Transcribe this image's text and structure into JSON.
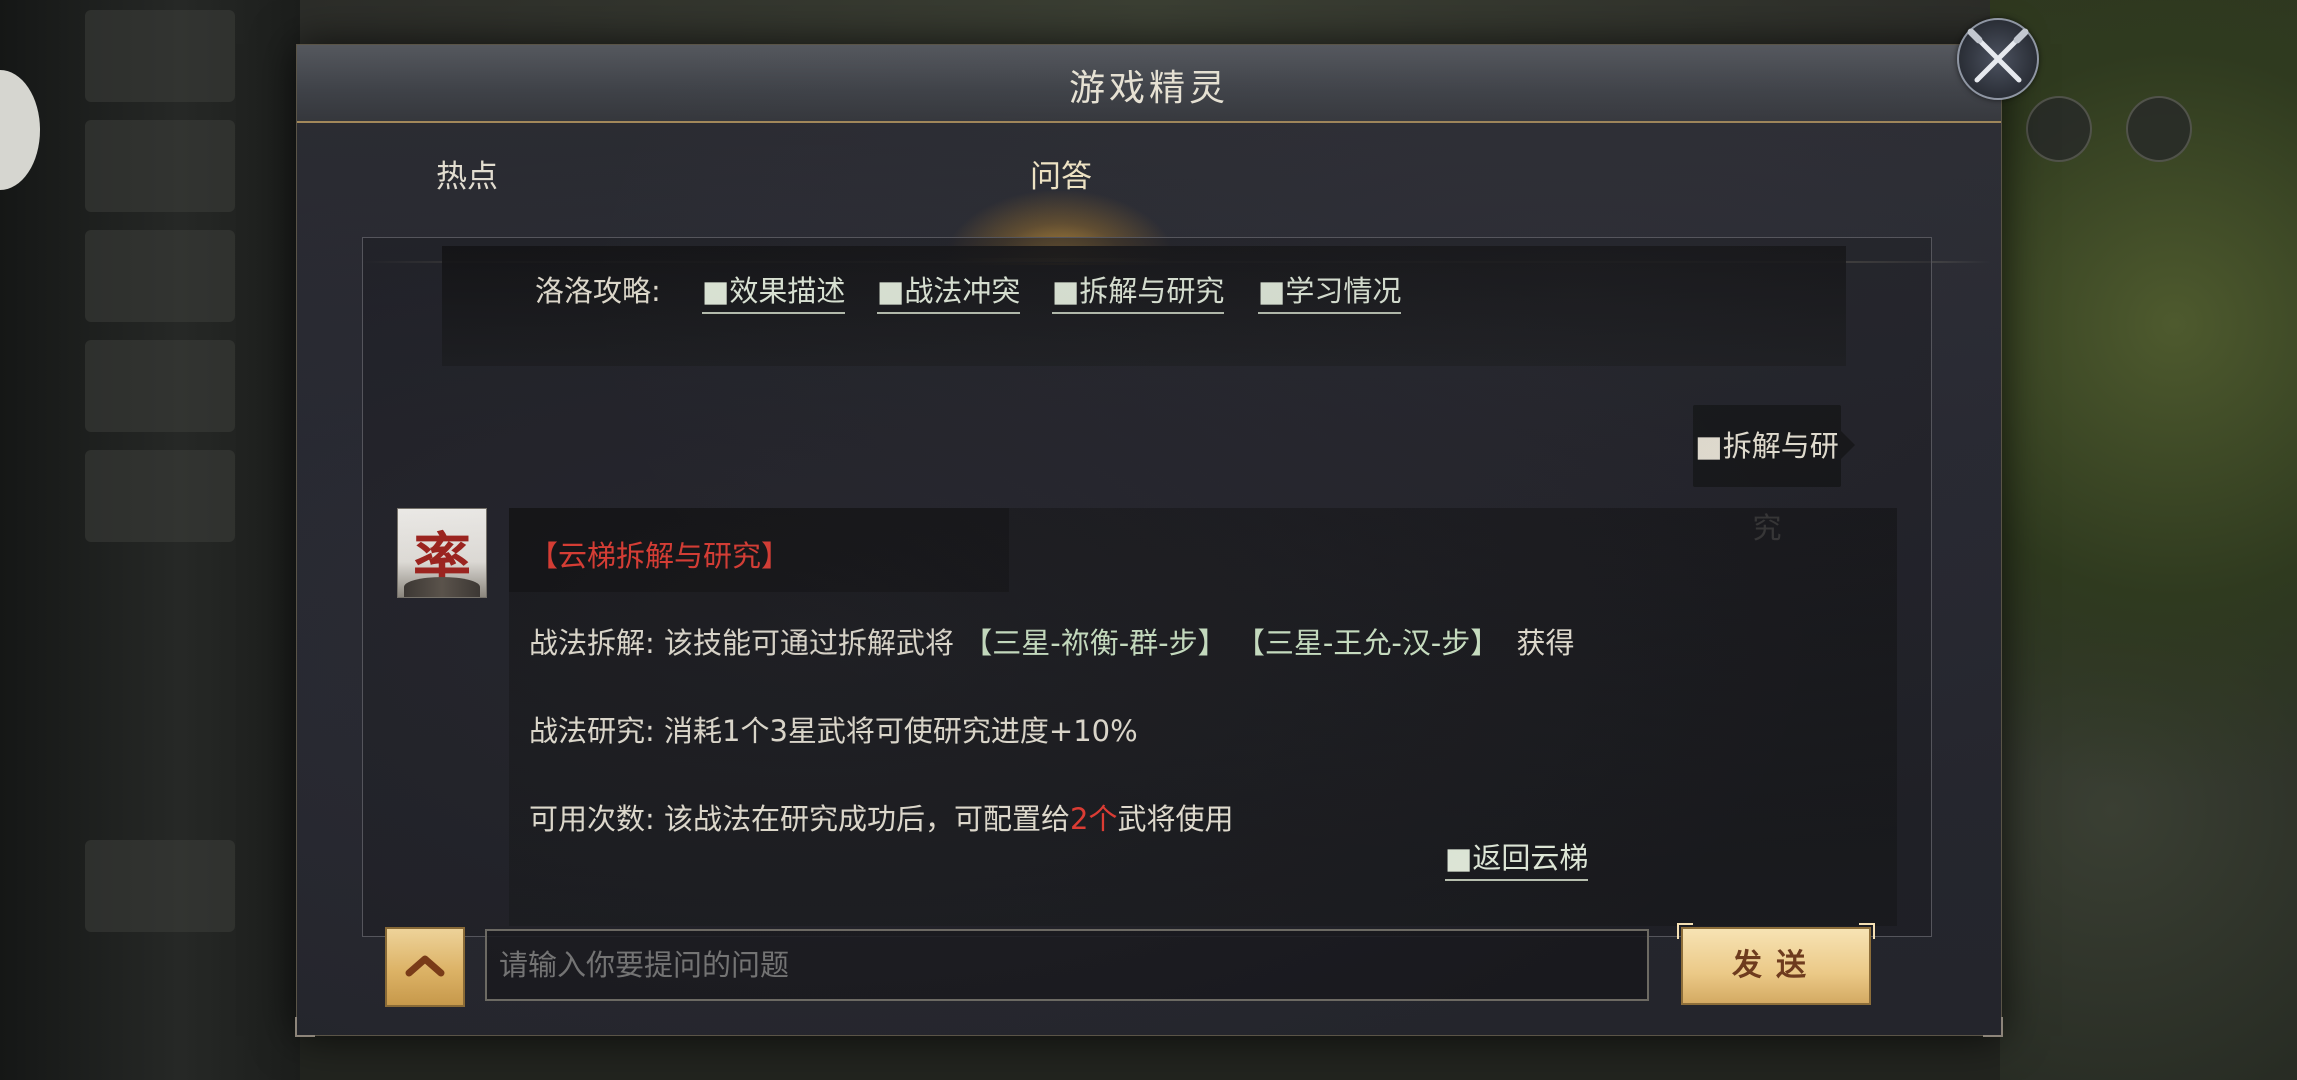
{
  "dialog": {
    "title": "游戏精灵"
  },
  "tabs": [
    {
      "label": "热点",
      "active": false
    },
    {
      "label": "问答",
      "active": true
    }
  ],
  "guide": {
    "label": "洛洛攻略:",
    "links": [
      "■效果描述",
      "■战法冲突",
      "■拆解与研究",
      "■学习情况"
    ]
  },
  "user_message": "■拆解与研究",
  "avatar": {
    "char": "率"
  },
  "answer": {
    "title": "【云梯拆解与研究】",
    "disassemble_label": "战法拆解:",
    "disassemble_text": "该技能可通过拆解武将",
    "generals": [
      "【三星-祢衡-群-步】",
      "【三星-王允-汉-步】"
    ],
    "disassemble_suffix": "获得",
    "research_label": "战法研究:",
    "research_text": "消耗1个3星武将可使研究进度+10%",
    "uses_label": "可用次数:",
    "uses_text_before": "该战法在研究成功后，可配置给",
    "uses_count": "2个",
    "uses_text_after": "武将使用",
    "back_link": "■返回云梯"
  },
  "input": {
    "placeholder": "请输入你要提问的问题"
  },
  "send_label": "发送",
  "colors": {
    "accent_gold": "#e0b566",
    "highlight_red": "#e03a30",
    "link_green": "#dfe8d8"
  }
}
